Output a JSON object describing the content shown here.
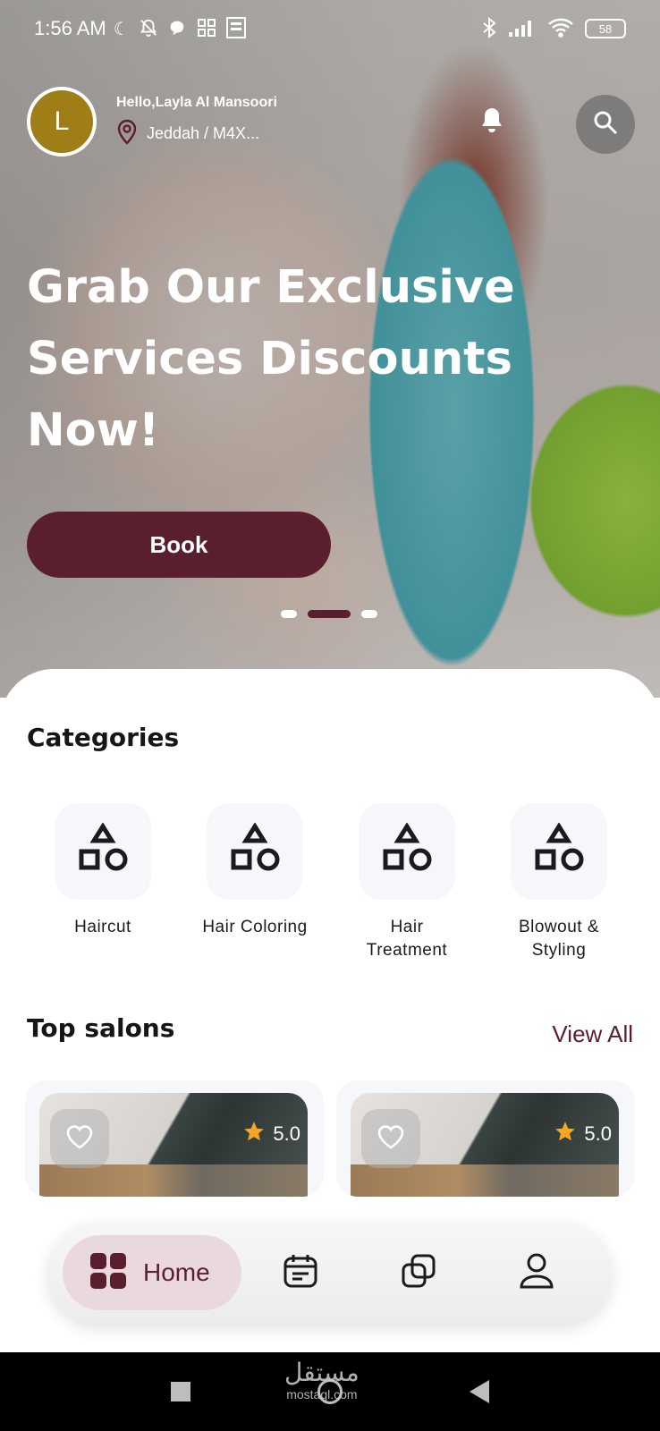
{
  "status_bar": {
    "time": "1:56 AM",
    "battery": "58",
    "icons_left": [
      "moon-icon",
      "bell-off-icon",
      "chat-icon",
      "apps-icon",
      "qr-icon"
    ],
    "icons_right": [
      "bluetooth-icon",
      "signal-icon",
      "wifi-icon"
    ]
  },
  "header": {
    "avatar_initial": "L",
    "greeting": "Hello,Layla Al Mansoori",
    "location": "Jeddah / M4X...",
    "icons": [
      "location-pin-icon",
      "bell-icon",
      "search-icon"
    ]
  },
  "hero": {
    "title": "Grab Our Exclusive Services Discounts Now!",
    "book_label": "Book",
    "carousel_active_index": 1,
    "carousel_count": 3
  },
  "categories": {
    "title": "Categories",
    "items": [
      {
        "label": "Haircut",
        "icon": "shapes-icon"
      },
      {
        "label": "Hair Coloring",
        "icon": "shapes-icon"
      },
      {
        "label": "Hair Treatment",
        "icon": "shapes-icon"
      },
      {
        "label": "Blowout & Styling",
        "icon": "shapes-icon"
      }
    ]
  },
  "top_salons": {
    "title": "Top salons",
    "view_all": "View All",
    "cards": [
      {
        "rating": "5.0",
        "icons": [
          "heart-icon",
          "star-icon"
        ]
      },
      {
        "rating": "5.0",
        "icons": [
          "heart-icon",
          "star-icon"
        ]
      }
    ]
  },
  "bottom_nav": {
    "home_label": "Home",
    "items": [
      "home-grid-icon",
      "calendar-icon",
      "copy-icon",
      "profile-icon"
    ]
  },
  "colors": {
    "accent": "#5a1f2e",
    "avatar": "#a07e16",
    "nav_active_bg": "#ead9dc",
    "star": "#f5a623"
  },
  "watermark": {
    "brand": "مستقل",
    "site": "mostaql.com"
  }
}
